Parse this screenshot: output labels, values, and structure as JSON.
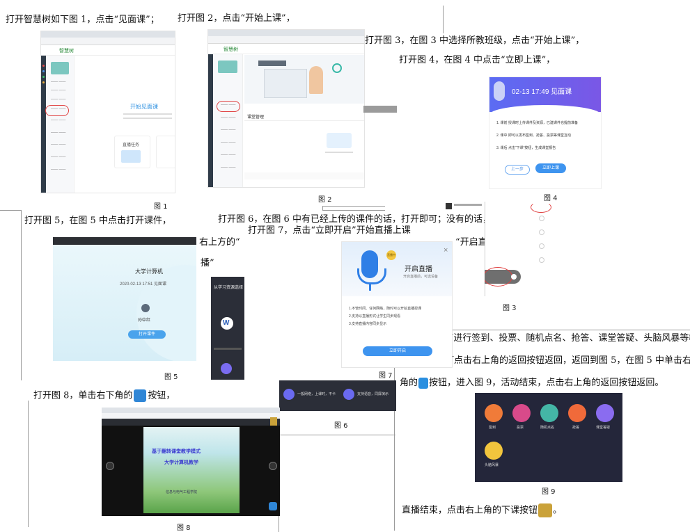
{
  "steps": {
    "s1": "打开智慧树如下图 1，点击“见面课”；",
    "s2": "打开图 2，点击“开始上课”，",
    "s3": "打开图 3，在图 3 中选择所教班级，点击“开始上课”，",
    "s4": "打开图 4，在图 4 中点击“立即上课”，",
    "s5": "打开图 5，在图 5 中点击打开课件，",
    "s6": "打开图 6，在图 6 中有已经上传的课件的话，打开即可；没有的话，点击",
    "s6b": "右上方的“",
    "s6c": "播”",
    "s7": "打开图 7，点击“立即开启”开始直播上课",
    "s7b": "“开启直",
    "s8a": "打开图 8，单击右下角的",
    "s8b": "按钮，",
    "s9a": "打开图 9，可进行签到、投票、随机点名、抢答、课堂答疑、头脑风暴等教",
    "s9b": "学活动。也可点击右上角的返回按钮返回，返回到图 5，在图 5 中单击右下",
    "s9c": "角的",
    "s9d": "按钮，进入图 9，活动结束，点击右上角的返回按钮返回。",
    "s10a": "直播结束，点击右上角的下课按钮",
    "s10b": "。"
  },
  "captions": {
    "f1": "图 1",
    "f2": "图 2",
    "f3": "图 3",
    "f4": "图 4",
    "f5": "图 5",
    "f6": "图 6",
    "f7": "图 7",
    "f8": "图 8",
    "f9": "图 9"
  },
  "fig1": {
    "logo": "智慧树",
    "heading": "开始见面课",
    "btn1": "直播任务"
  },
  "fig2": {
    "section": "课堂管理"
  },
  "fig4": {
    "title": "02-13 17:49 见面课",
    "step1": "1. 课前  授课时上传课件及资源，已建课件也提前准备",
    "step2": "2. 课中  即可以发布签到、抢答、投票等课堂互动",
    "step3": "3. 课后  点击“下课”按钮，生成课堂报告",
    "cancel": "上一步",
    "confirm": "立即上课"
  },
  "fig5": {
    "course": "大学计算机",
    "time": "2020-02-13 17:51 见面课",
    "name": "孙中红",
    "btn": "打开课件"
  },
  "fig6": {
    "header": "从学习资源选择",
    "item1": "大学计算机课件",
    "f1": "一般网络，上课时，不卡",
    "f2": "支持语音，同屏演示"
  },
  "fig7": {
    "title": "开启直播",
    "sub": "开启直播前，可选设备",
    "tag": "直播中",
    "line1": "1.不管时间、任何网络，随时可以开始直播授课",
    "line2": "2.支持以直播形式让学生同步观看",
    "line3": "3.支持直播内容同步显示",
    "btn": "立即开启"
  },
  "fig8": {
    "title1": "基于翻转课堂教学模式",
    "title2": "大学计算机教学",
    "author": "信息与电气工程学院"
  },
  "fig9": {
    "items": [
      "签到",
      "投票",
      "随机点名",
      "抢答",
      "课堂答疑",
      "头脑风暴"
    ]
  }
}
